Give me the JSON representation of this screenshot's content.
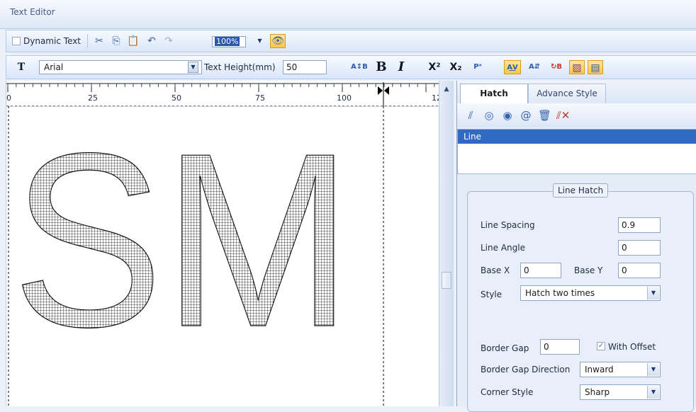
{
  "window": {
    "title": "Text Editor"
  },
  "toolbar1": {
    "dynamic_text_label": "Dynamic Text",
    "zoom_value": "100%"
  },
  "toolbar2": {
    "font_name": "Arial",
    "text_height_label": "Text Height(mm)",
    "text_height_value": "50"
  },
  "ruler": {
    "ticks": [
      "0",
      "25",
      "50",
      "75",
      "100",
      "12"
    ]
  },
  "canvas": {
    "text": "SM"
  },
  "panel": {
    "tabs": [
      "Hatch",
      "Advance Style"
    ],
    "list_items": [
      "Line"
    ],
    "group_title": "Line Hatch",
    "line_spacing_label": "Line Spacing",
    "line_spacing_value": "0.9",
    "line_angle_label": "Line Angle",
    "line_angle_value": "0",
    "base_x_label": "Base X",
    "base_x_value": "0",
    "base_y_label": "Base Y",
    "base_y_value": "0",
    "style_label": "Style",
    "style_value": "Hatch two times",
    "border_gap_label": "Border Gap",
    "border_gap_value": "0",
    "with_offset_label": "With Offset",
    "border_gap_direction_label": "Border Gap Direction",
    "border_gap_direction_value": "Inward",
    "corner_style_label": "Corner Style",
    "corner_style_value": "Sharp"
  }
}
